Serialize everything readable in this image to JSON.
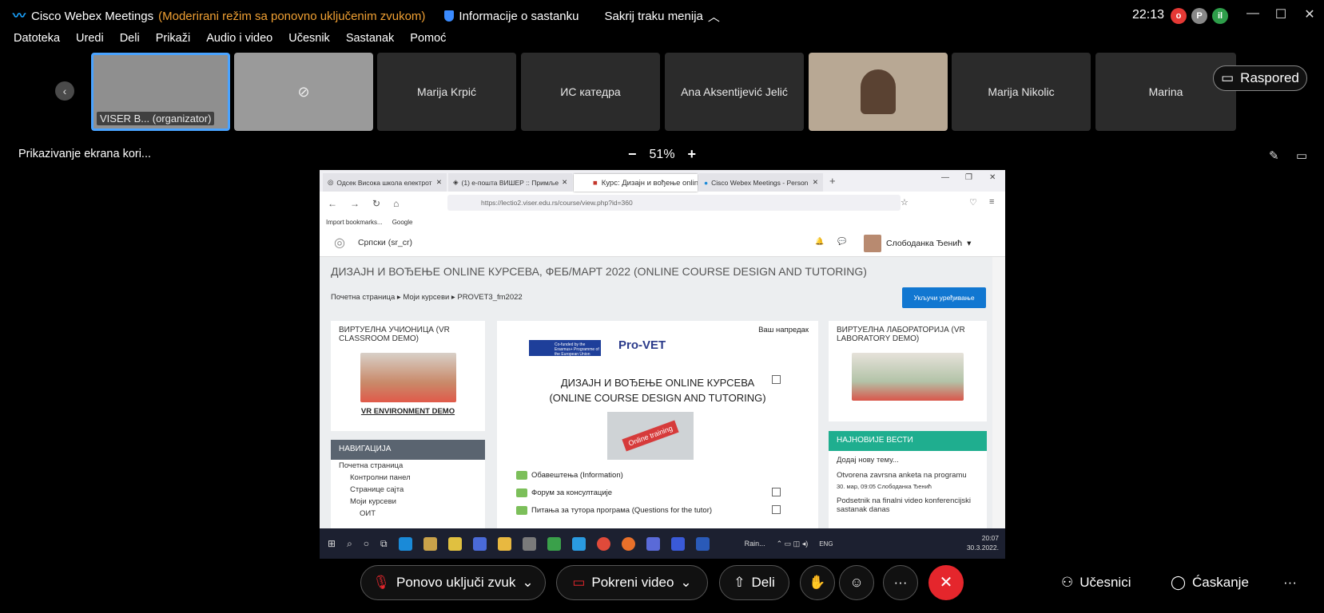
{
  "window": {
    "app_name": "Cisco Webex Meetings",
    "mode_text": "(Moderirani režim sa ponovno uključenim zvukom)",
    "info_label": "Informacije o sastanku",
    "hide_menu_label": "Sakrij traku menija",
    "time": "22:13",
    "indicators": [
      "o",
      "P",
      "il"
    ]
  },
  "menu": [
    "Datoteka",
    "Uredi",
    "Deli",
    "Prikaži",
    "Audio i video",
    "Učesnik",
    "Sastanak",
    "Pomoć"
  ],
  "participants": [
    {
      "name": "VISER B... (organizator)",
      "video": true
    },
    {
      "name": "",
      "video_off": true
    },
    {
      "name": "Marija Krpić"
    },
    {
      "name": "ИС катедра"
    },
    {
      "name": "Ana Aksentijević Jelić"
    },
    {
      "name": "",
      "video": true
    },
    {
      "name": "Marija Nikolic"
    },
    {
      "name": "Marina"
    }
  ],
  "layout_button": "Raspored",
  "share": {
    "label": "Prikazivanje ekrana kori...",
    "zoom": "51%",
    "minus": "−",
    "plus": "+"
  },
  "browser": {
    "tabs": [
      "Одсек Висока школа електрот",
      "(1) е-пошта ВИШЕР :: Примље",
      "Курс: Дизајн и вођење online",
      "Cisco Webex Meetings - Person"
    ],
    "url": "https://lectio2.viser.edu.rs/course/view.php?id=360",
    "bookmarks": [
      "Import bookmarks...",
      "Google"
    ]
  },
  "moodle": {
    "language": "Српски (sr_cr)",
    "user": "Слободанка Ђенић",
    "course_title": "ДИЗАЈН И ВОЂЕЊЕ ONLINE КУРСЕВА, ФЕБ/МАРТ 2022 (ONLINE COURSE DESIGN AND TUTORING)",
    "breadcrumb": [
      "Почетна страница",
      "Моји курсеви",
      "PROVET3_fm2022"
    ],
    "edit_button": "Укључи уређивање",
    "left_block_title": "ВИРТУЕЛНА УЧИОНИЦА (VR CLASSROOM DEMO)",
    "left_block_link": "VR ENVIRONMENT DEMO",
    "nav_title": "НАВИГАЦИЈА",
    "nav_items": [
      "Почетна страница",
      "Контролни панел",
      "Странице сајта",
      "Моји курсеви",
      "ОИТ"
    ],
    "progress_label": "Ваш напредак",
    "eu_text": "Co-funded by the Erasmus+ Programme of the European Union",
    "provet": "Pro-VET",
    "course_heading_1": "ДИЗАЈН И ВОЂЕЊЕ ONLINE КУРСЕВА",
    "course_heading_2": "(ONLINE COURSE DESIGN AND TUTORING)",
    "training_img_text": "Online training",
    "activities": [
      "Обавештења (Information)",
      "Форум за консултације",
      "Питања за тутора програма (Questions for the tutor)"
    ],
    "right_block_title": "ВИРТУЕЛНА ЛАБОРАТОРИЈА (VR LABORATORY DEMO)",
    "news_title": "НАЈНОВИЈЕ ВЕСТИ",
    "news_add": "Додај нову тему...",
    "news_items": [
      {
        "title": "Otvorena zavrsna anketa na programu",
        "meta": "30. мар, 09:05  Слободанка Ђенић"
      },
      {
        "title": "Podsetnik na finalni video konferencijski sastanak danas",
        "meta": ""
      }
    ]
  },
  "taskbar": {
    "weather": "Rain...",
    "lang": "ENG",
    "time": "20:07",
    "date": "30.3.2022."
  },
  "controls": {
    "unmute": "Ponovo uključi zvuk",
    "video": "Pokreni video",
    "share": "Deli",
    "end": "✕",
    "more": "···",
    "participants": "Učesnici",
    "chat": "Ćaskanje",
    "overflow": "···"
  }
}
